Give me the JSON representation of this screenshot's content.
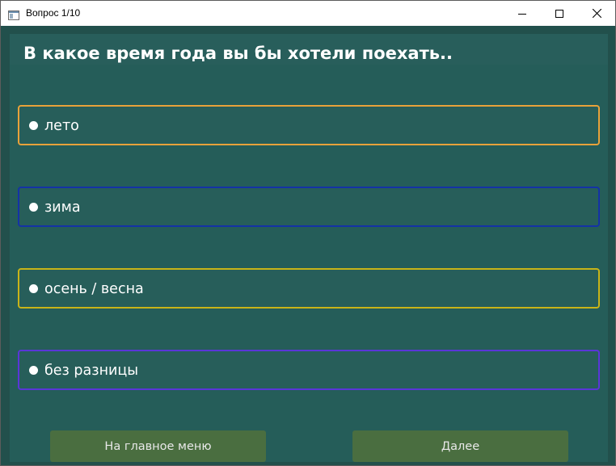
{
  "window": {
    "title": "Вопрос 1/10",
    "icon": "window-app-icon",
    "controls": {
      "minimize_icon": "minimize-icon",
      "maximize_icon": "maximize-icon",
      "close_icon": "close-icon"
    }
  },
  "question": {
    "text": "В какое время года вы бы хотели поехать.."
  },
  "options": [
    {
      "label": "лето",
      "border_color": "#e8a23a",
      "selected": false
    },
    {
      "label": "зима",
      "border_color": "#1432a6",
      "selected": false
    },
    {
      "label": "осень / весна",
      "border_color": "#c8b418",
      "selected": false
    },
    {
      "label": "без разницы",
      "border_color": "#5a36d8",
      "selected": false
    }
  ],
  "buttons": {
    "main_menu": "На главное меню",
    "next": "Далее"
  },
  "colors": {
    "background": "#22504c",
    "panel": "#255d59",
    "button": "#4a6e40",
    "text": "#ffffff"
  }
}
